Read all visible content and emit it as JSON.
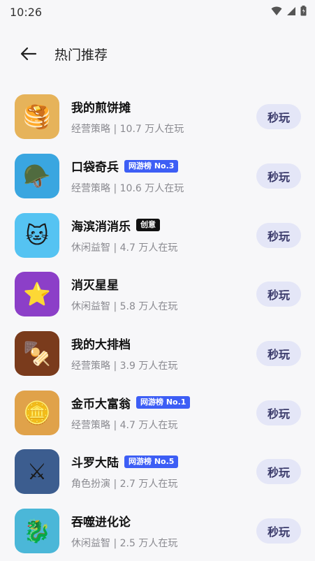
{
  "status_bar": {
    "time": "10:26"
  },
  "header": {
    "title": "热门推荐"
  },
  "games": [
    {
      "name": "我的煎饼摊",
      "badge": "",
      "category": "经营策略",
      "players": "10.7 万人在玩",
      "icon_color": "#e6b35a",
      "icon_glyph": "🥞",
      "play_label": "秒玩"
    },
    {
      "name": "口袋奇兵",
      "badge": "网游榜 No.3",
      "badge_style": "blue",
      "category": "经营策略",
      "players": "10.6 万人在玩",
      "icon_color": "#3aa6e0",
      "icon_glyph": "🪖",
      "play_label": "秒玩"
    },
    {
      "name": "海滨消消乐",
      "badge": "创意",
      "badge_style": "black",
      "category": "休闲益智",
      "players": "4.7 万人在玩",
      "icon_color": "#55c3f2",
      "icon_glyph": "🐱",
      "play_label": "秒玩"
    },
    {
      "name": "消灭星星",
      "badge": "",
      "category": "休闲益智",
      "players": "5.8 万人在玩",
      "icon_color": "#8c3fc8",
      "icon_glyph": "⭐",
      "play_label": "秒玩"
    },
    {
      "name": "我的大排档",
      "badge": "",
      "category": "经营策略",
      "players": "3.9 万人在玩",
      "icon_color": "#7a3b1c",
      "icon_glyph": "🍢",
      "play_label": "秒玩"
    },
    {
      "name": "金币大富翁",
      "badge": "网游榜 No.1",
      "badge_style": "blue",
      "category": "经营策略",
      "players": "4.7 万人在玩",
      "icon_color": "#e0a24a",
      "icon_glyph": "🪙",
      "play_label": "秒玩"
    },
    {
      "name": "斗罗大陆",
      "badge": "网游榜 No.5",
      "badge_style": "blue",
      "category": "角色扮演",
      "players": "2.7 万人在玩",
      "icon_color": "#3c5d8f",
      "icon_glyph": "⚔",
      "play_label": "秒玩"
    },
    {
      "name": "吞噬进化论",
      "badge": "",
      "category": "休闲益智",
      "players": "2.5 万人在玩",
      "icon_color": "#4bb7d8",
      "icon_glyph": "🐉",
      "play_label": "秒玩"
    }
  ]
}
